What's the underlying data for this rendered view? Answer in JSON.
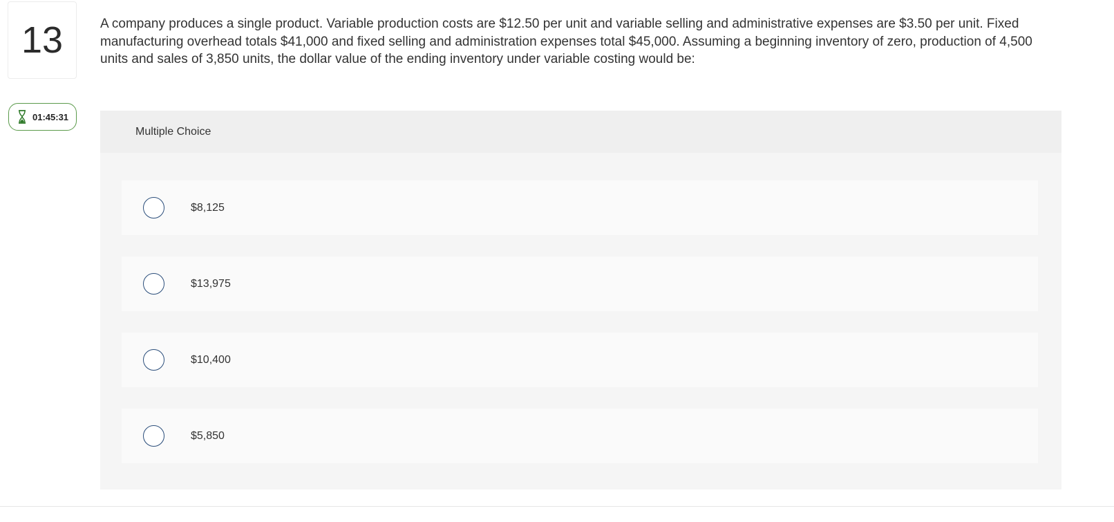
{
  "question": {
    "number": "13",
    "text": "A company produces a single product. Variable production costs are $12.50 per unit and variable selling and administrative expenses are $3.50 per unit. Fixed manufacturing overhead totals $41,000 and fixed selling and administration expenses total $45,000. Assuming a beginning inventory of zero, production of 4,500 units and sales of 3,850 units, the dollar value of the ending inventory under variable costing would be:"
  },
  "timer": {
    "icon": "hourglass-icon",
    "value": "01:45:31",
    "color": "#5a9a4a"
  },
  "choices": {
    "header": "Multiple Choice",
    "options": [
      {
        "label": "$8,125"
      },
      {
        "label": "$13,975"
      },
      {
        "label": "$10,400"
      },
      {
        "label": "$5,850"
      }
    ]
  }
}
